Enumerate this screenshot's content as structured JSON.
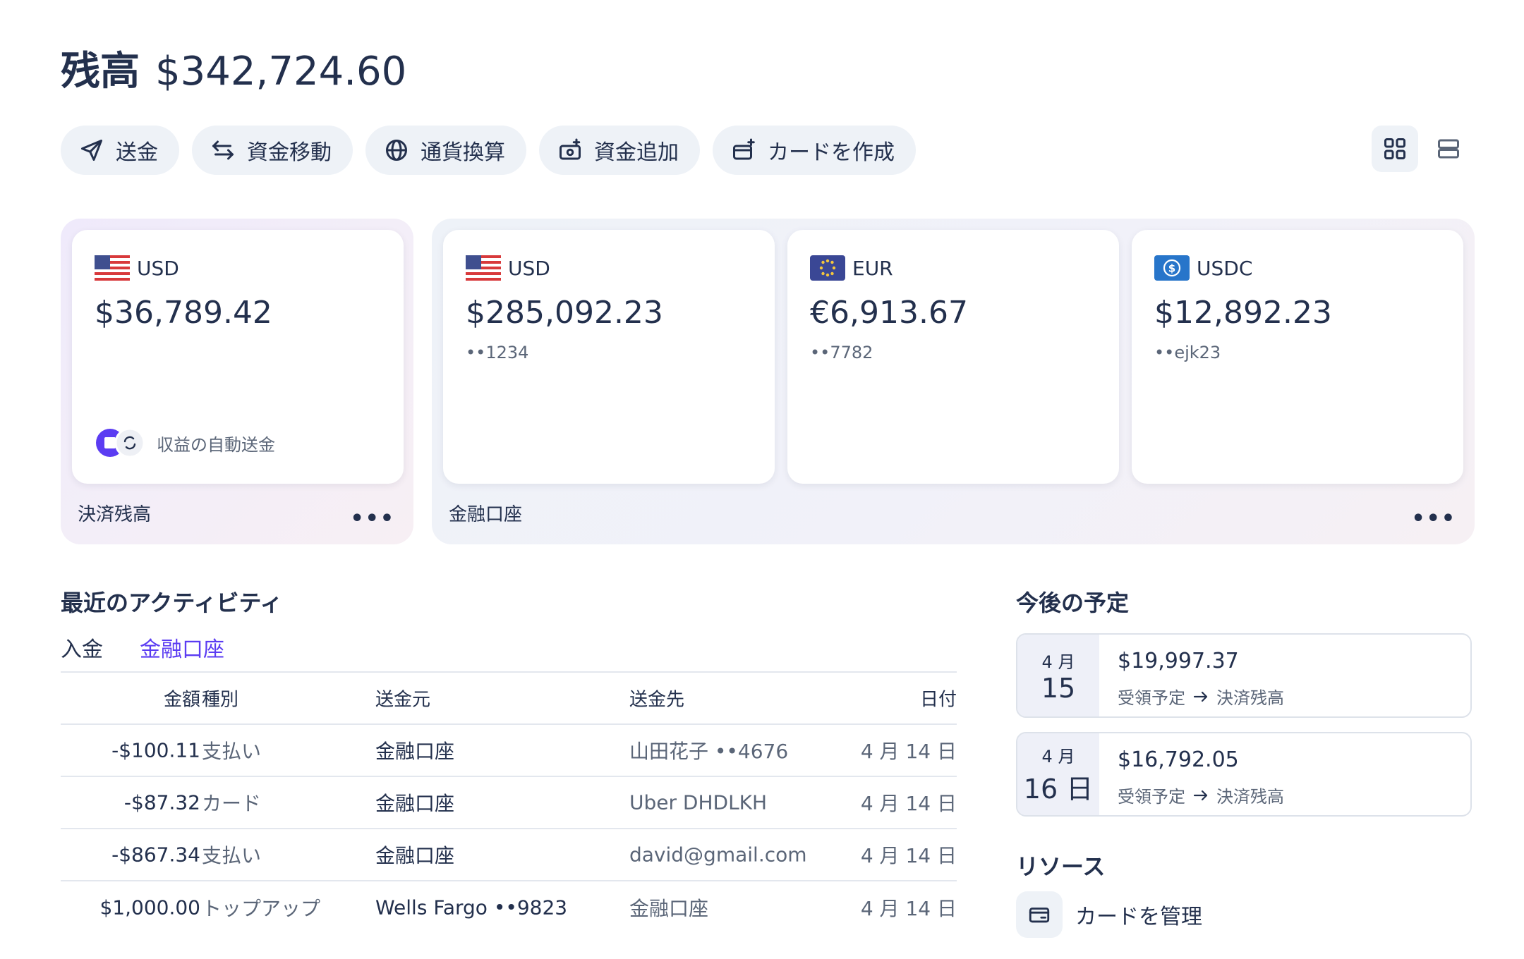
{
  "header": {
    "balance_label": "残高",
    "balance_amount": "$342,724.60"
  },
  "actions": [
    {
      "label": "送金",
      "icon": "send-icon"
    },
    {
      "label": "資金移動",
      "icon": "transfer-arrows-icon"
    },
    {
      "label": "通貨換算",
      "icon": "globe-icon"
    },
    {
      "label": "資金追加",
      "icon": "add-funds-icon"
    },
    {
      "label": "カードを作成",
      "icon": "create-card-icon"
    }
  ],
  "groups": {
    "payment": {
      "label": "決済残高",
      "more": "•••",
      "card": {
        "currency": "USD",
        "balance": "$36,789.42",
        "auto_label": "収益の自動送金"
      }
    },
    "financial": {
      "label": "金融口座",
      "more": "•••",
      "cards": [
        {
          "currency": "USD",
          "balance": "$285,092.23",
          "account": "••1234"
        },
        {
          "currency": "EUR",
          "balance": "€6,913.67",
          "account": "••7782"
        },
        {
          "currency": "USDC",
          "balance": "$12,892.23",
          "account": "••ejk23"
        }
      ]
    }
  },
  "activity": {
    "title": "最近のアクティビティ",
    "filters": [
      {
        "label": "入金"
      },
      {
        "label": "金融口座"
      }
    ],
    "columns": {
      "amount": "金額",
      "type": "種別",
      "from": "送金元",
      "to": "送金先",
      "date": "日付"
    },
    "rows": [
      {
        "amount": "-$100.11",
        "type": "支払い",
        "from": "金融口座",
        "to": "山田花子 ••4676",
        "date": "4 月 14 日"
      },
      {
        "amount": "-$87.32",
        "type": "カード",
        "from": "金融口座",
        "to": "Uber DHDLKH",
        "date": "4 月 14 日"
      },
      {
        "amount": "-$867.34",
        "type": "支払い",
        "from": "金融口座",
        "to": "david@gmail.com",
        "date": "4 月 14 日"
      },
      {
        "amount": "$1,000.00",
        "type": "トップアップ",
        "from": "Wells Fargo ••9823",
        "to": "金融口座",
        "date": "4 月 14 日"
      }
    ]
  },
  "upcoming": {
    "title": "今後の予定",
    "items": [
      {
        "month": "4 月",
        "day": "15",
        "amount": "$19,997.37",
        "desc_from": "受領予定",
        "desc_to": "決済残高"
      },
      {
        "month": "4 月",
        "day": "16 日",
        "amount": "$16,792.05",
        "desc_from": "受領予定",
        "desc_to": "決済残高"
      }
    ]
  },
  "resources": {
    "title": "リソース",
    "items": [
      {
        "label": "カードを管理",
        "icon": "card-icon"
      }
    ]
  }
}
